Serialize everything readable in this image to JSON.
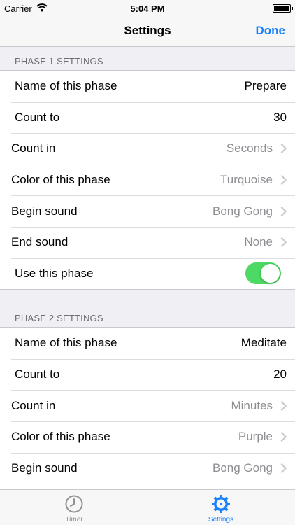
{
  "status_bar": {
    "carrier": "Carrier",
    "time": "5:04 PM"
  },
  "nav": {
    "title": "Settings",
    "done_label": "Done"
  },
  "sections": [
    {
      "header": "PHASE 1 SETTINGS",
      "rows": [
        {
          "label": "Name of this phase",
          "value": "Prepare"
        },
        {
          "label": "Count to",
          "value": "30"
        },
        {
          "label": "Count in",
          "value": "Seconds"
        },
        {
          "label": "Color of this phase",
          "value": "Turquoise"
        },
        {
          "label": "Begin sound",
          "value": "Bong Gong"
        },
        {
          "label": "End sound",
          "value": "None"
        },
        {
          "label": "Use this phase",
          "toggle_on": true
        }
      ]
    },
    {
      "header": "PHASE 2 SETTINGS",
      "rows": [
        {
          "label": "Name of this phase",
          "value": "Meditate"
        },
        {
          "label": "Count to",
          "value": "20"
        },
        {
          "label": "Count in",
          "value": "Minutes"
        },
        {
          "label": "Color of this phase",
          "value": "Purple"
        },
        {
          "label": "Begin sound",
          "value": "Bong Gong"
        }
      ]
    }
  ],
  "tab_bar": {
    "tabs": [
      {
        "label": "Timer",
        "icon": "clock-icon",
        "selected": false
      },
      {
        "label": "Settings",
        "icon": "gear-icon",
        "selected": true
      }
    ]
  },
  "colors": {
    "accent": "#1a82fb",
    "toggle_on": "#4cd964",
    "secondary_text": "#8e8e93"
  }
}
